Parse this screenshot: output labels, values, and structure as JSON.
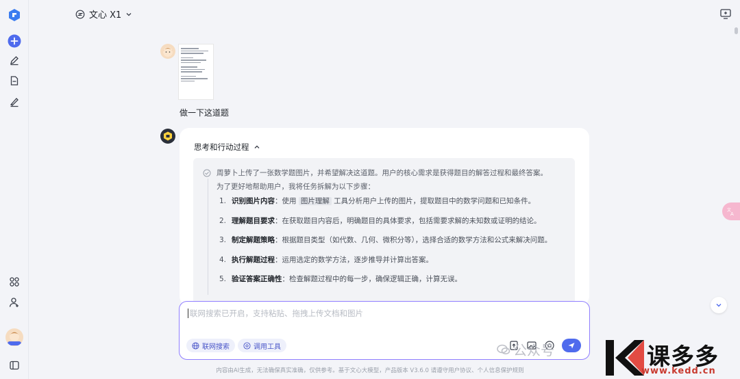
{
  "header": {
    "model_name": "文心 X1"
  },
  "user_message": {
    "text": "做一下这道题"
  },
  "assistant": {
    "thinking_title": "思考和行动过程",
    "summary": "周萝卜上传了一张数学题图片，并希望解决这道题。用户的核心需求是获得题目的解答过程和最终答案。",
    "intro": "为了更好地帮助用户，我将任务拆解为以下步骤：",
    "steps": [
      {
        "num": "1.",
        "title": "识别图片内容",
        "pre": "：使用 ",
        "tag": "图片理解",
        "post": " 工具分析用户上传的图片，提取题目中的数学问题和已知条件。"
      },
      {
        "num": "2.",
        "title": "理解题目要求",
        "text": "：在获取题目内容后，明确题目的具体要求，包括需要求解的未知数或证明的结论。"
      },
      {
        "num": "3.",
        "title": "制定解题策略",
        "text": "：根据题目类型（如代数、几何、微积分等），选择合适的数学方法和公式来解决问题。"
      },
      {
        "num": "4.",
        "title": "执行解题过程",
        "text": "：运用选定的数学方法，逐步推导并计算出答案。"
      },
      {
        "num": "5.",
        "title": "验证答案正确性",
        "text": "：检查解题过程中的每一步，确保逻辑正确，计算无误。"
      }
    ]
  },
  "input": {
    "placeholder": "联网搜索已开启，支持粘贴、拖拽上传文档和图片",
    "web_search_label": "联网搜索",
    "tools_label": "调用工具"
  },
  "footer": {
    "text": "内容由AI生成，无法确保真实准确，仅供参考。基于文心大模型，产品版本 V3.6.0 请遵守用户协议、个人信息保护规则"
  },
  "watermark": {
    "gzh": "公众号",
    "brand": "课多多",
    "url": "www.kedd.cn"
  },
  "colors": {
    "accent": "#4f6bed",
    "input_border": "#8f7dff",
    "new_chat": "#4f6bed"
  }
}
